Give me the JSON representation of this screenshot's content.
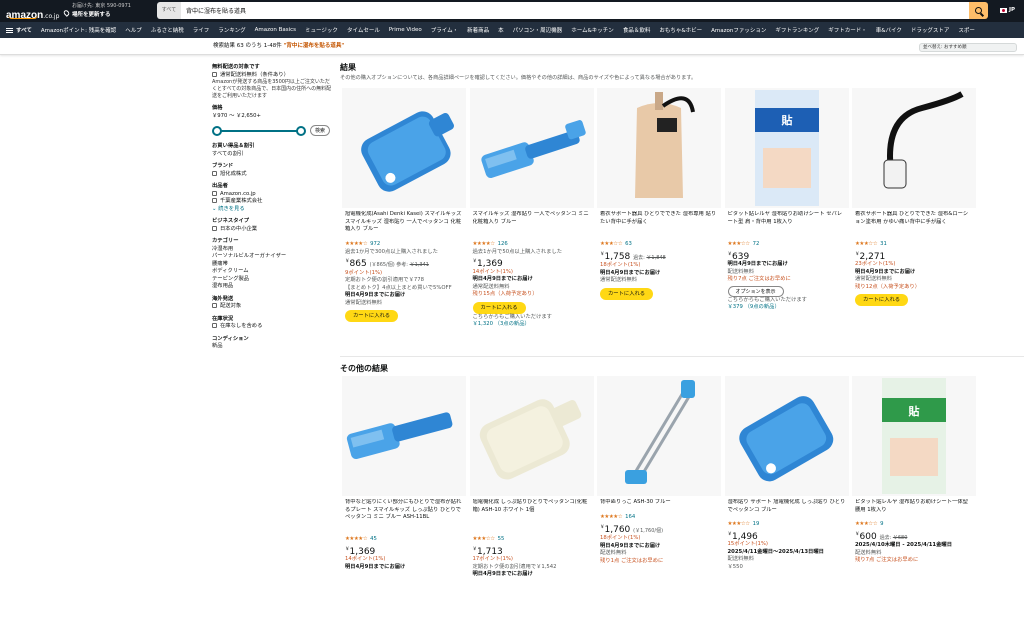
{
  "header": {
    "logo_text": "amazon",
    "logo_suffix": ".co.jp",
    "deliver_line1": "お届け先: 東京 590-0971",
    "deliver_line2": "場所を更新する",
    "search_category": "すべて",
    "search_value": "背中に湿布を貼る道具",
    "lang": "JP"
  },
  "nav": {
    "all_label": "すべて",
    "items": [
      "Amazonポイント: 残高を確認",
      "ヘルプ",
      "ふるさと納税",
      "ライフ",
      "ランキング",
      "Amazon Basics",
      "ミュージック",
      "タイムセール",
      "Prime Video",
      "プライム・",
      "新着商品",
      "本",
      "パソコン・周辺機器",
      "ホーム&キッチン",
      "食品＆飲料",
      "おもちゃ&ホビー",
      "Amazonファッション",
      "ギフトランキング",
      "ギフトカード・",
      "車&バイク",
      "ドラッグストア",
      "スポー"
    ]
  },
  "results": {
    "prefix": "検索結果 63 のうち 1-48件 ",
    "query": "\"背中に湿布を貼る道具\"",
    "sort": "並べ替え: おすすめ順"
  },
  "sidebar": {
    "free_ship_h": "無料配送の対象です",
    "free_ship_opt": "通常配送料無料（条件あり）",
    "free_ship_note": "Amazonが発送する商品を3500円以上ご注文いただくとすべての対象商品で、日本国内の住所への無料配送をご利用いただけます",
    "price_h": "価格",
    "price_range": "￥970 〜 ￥2,650+",
    "go": "検索",
    "deals_h": "お買い得品＆割引",
    "deals_opt": "すべての割引",
    "brand_h": "ブランド",
    "brand_opt": "旭化成株式",
    "seller_h": "出品者",
    "seller_1": "Amazon.co.jp",
    "seller_2": "千葉産業株式会社",
    "seller_more": "続きを見る",
    "biz_h": "ビジネスタイプ",
    "biz_opt": "日本の中小企業",
    "cat_h": "カテゴリー",
    "cats": [
      "冷湿布用",
      "パーソナルビルオーガナイザー",
      "腰痛帯",
      "ボディクリーム",
      "テーピング製品",
      "湿布用品"
    ],
    "ship_h": "海外発送",
    "ship_opt": "配送対象",
    "stock_h": "在庫状況",
    "stock_opt": "在庫なしを含める",
    "cond_h": "コンディション",
    "cond_opt": "新品"
  },
  "section1": {
    "title": "結果",
    "sub": "その他の購入オプションについては、各商品詳細ページを確認してください。価格やその他の詳細は、商品のサイズや色によって異なる場合があります。"
  },
  "section2": {
    "title": "その他の結果"
  },
  "cards_row1": [
    {
      "title": "旭電機化成(Asahi Denki Kasei) スマイルキッズ スマイルキッズ 湿布貼り 一人でペッタンコ 化粧箱入り ブルー",
      "stars": "★★★★☆",
      "rating": "972",
      "bought": "過去1か月で300点以上購入されました",
      "price": "865",
      "ref": "(￥865/個) 参考: ",
      "old": "￥1,341",
      "pts": "9ポイント(1%)",
      "l1": "定期おトク便の割引適用で￥778",
      "l2": "【まとめトク】4点以上まとめ買いで5%OFF",
      "l3": "明日4月9日までにお届け",
      "l4": "通常配送料無料",
      "cart": "カートに入れる"
    },
    {
      "title": "スマイルキッズ 湿布貼り 一人でペッタンコ ミニ 化粧箱入り ブルー",
      "stars": "★★★★☆",
      "rating": "126",
      "bought": "過去1か月で50点以上購入されました",
      "price": "1,369",
      "ref": "",
      "old": "",
      "pts": "14ポイント(1%)",
      "l1": "明日4月9日までにお届け",
      "l2": "通常配送料無料",
      "l3": "残り15点（入荷予定あり）",
      "l4": "",
      "cart": "カートに入れる",
      "extra": "こちらからもご購入いただけます",
      "extra2": "￥1,320 （3点の新品）"
    },
    {
      "title": "着衣サポート器具 ひとりでできた 湿布専用 貼りたい背中に手が届く",
      "stars": "★★★☆☆",
      "rating": "63",
      "bought": "",
      "price": "1,758",
      "ref": "過去: ",
      "old": "￥1,848",
      "pts": "18ポイント(1%)",
      "l1": "明日4月9日までにお届け",
      "l2": "通常配送料無料",
      "l3": "",
      "l4": "",
      "cart": "カートに入れる"
    },
    {
      "title": "ピタット貼レルヤ 湿布貼りお助けシート セパレート型 肩・背中用 1枚入り",
      "stars": "★★★☆☆",
      "rating": "72",
      "bought": "",
      "price": "639",
      "ref": "",
      "old": "",
      "pts": "",
      "l1": "明日4月9日までにお届け",
      "l2": "配送料無料",
      "l3": "残り7点 ご注文はお早めに",
      "l4": "",
      "cart": "",
      "opt": "オプションを表示",
      "extra": "こちらからもご購入いただけます",
      "extra2": "￥379 （9点の新品）"
    },
    {
      "title": "着衣サポート器具 ひとりでできた 湿布&ローション塗布用 かゆい痛い背中に手が届く",
      "stars": "★★★☆☆",
      "rating": "31",
      "bought": "",
      "price": "2,271",
      "ref": "",
      "old": "",
      "pts": "23ポイント(1%)",
      "l1": "明日4月9日までにお届け",
      "l2": "通常配送料無料",
      "l3": "残り12点（入荷予定あり）",
      "l4": "",
      "cart": "カートに入れる"
    }
  ],
  "cards_row2": [
    {
      "title": "背中など貼りにくい部分にもひとりで湿布が貼れるプレート スマイルキッズ しっぷ貼り ひとりでペッタンコ ミニ ブルー ASH-11BL",
      "stars": "★★★★☆",
      "rating": "45",
      "price": "1,369",
      "pts": "14ポイント(1%)",
      "l1": "明日4月9日までにお届け"
    },
    {
      "title": "旭電機化成 しっぷ貼りひとりでペッタンコ(化粧箱) ASH-10 ホワイト 1個",
      "stars": "★★★☆☆",
      "rating": "55",
      "price": "1,713",
      "pts": "17ポイント(1%)",
      "l1": "定期おトク便の割引適用で￥1,542",
      "l2": "明日4月9日までにお届け"
    },
    {
      "title": "背中ぬりっこ ASH-30 ブルー",
      "stars": "★★★★☆",
      "rating": "164",
      "price": "1,760",
      "ref": "(￥1,760/個)",
      "pts": "18ポイント(1%)",
      "l1": "明日4月9日までにお届け",
      "l2": "配送料無料",
      "l3": "残り1点 ご注文はお早めに"
    },
    {
      "title": "湿布貼り サポート 旭電機化成 しっぷ貼り ひとりでペッタンコ ブルー",
      "stars": "★★★☆☆",
      "rating": "19",
      "price": "1,496",
      "pts": "15ポイント(1%)",
      "l1": "2025/4/11金曜日〜2025/4/13日曜日",
      "l2": "配送料無料",
      "l3": "￥550"
    },
    {
      "title": "ピタット貼レルヤ 湿布貼りお助けシート一体型 腰用 1枚入り",
      "stars": "★★★☆☆",
      "rating": "9",
      "price": "600",
      "ref": "過去: ",
      "old": "￥680",
      "pts": "",
      "l1": "2025/4/10木曜日 - 2025/4/11金曜日",
      "l2": "配送料無料",
      "l3": "残り7点 ご注文はお早めに"
    }
  ]
}
